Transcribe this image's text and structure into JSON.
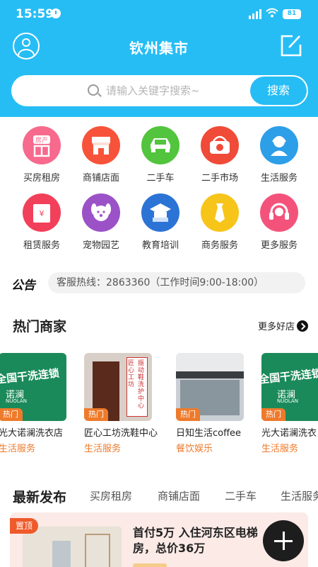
{
  "status": {
    "time": "15:59",
    "battery": "81"
  },
  "header": {
    "title": "钦州集市"
  },
  "search": {
    "placeholder": "请输入关键字搜索~",
    "button_label": "搜索"
  },
  "categories": [
    {
      "label": "买房租房",
      "icon": "house-icon",
      "color": "#f76a8d",
      "badge": "房产"
    },
    {
      "label": "商铺店面",
      "icon": "storefront-icon",
      "color": "#f7533a"
    },
    {
      "label": "二手车",
      "icon": "car-icon",
      "color": "#52c43d"
    },
    {
      "label": "二手市场",
      "icon": "basket-icon",
      "color": "#f04a38"
    },
    {
      "label": "生活服务",
      "icon": "service-person-icon",
      "color": "#2d9ee8"
    },
    {
      "label": "租赁服务",
      "icon": "rental-receipt-icon",
      "color": "#f2405a"
    },
    {
      "label": "宠物园艺",
      "icon": "dog-icon",
      "color": "#9b52c7"
    },
    {
      "label": "教育培训",
      "icon": "graduation-cap-icon",
      "color": "#2c73d6"
    },
    {
      "label": "商务服务",
      "icon": "necktie-icon",
      "color": "#f7c51a"
    },
    {
      "label": "更多服务",
      "icon": "headset-icon",
      "color": "#f3537a"
    }
  ],
  "notice": {
    "logo": "公告",
    "text": "客服热线：2863360（工作时间9:00-18:00）"
  },
  "hot_merchants": {
    "title": "热门商家",
    "more_label": "更多好店",
    "shops": [
      {
        "tag": "热门",
        "name": "光大诺澜洗衣店",
        "category": "生活服务",
        "sign": "全国干洗连锁",
        "brand": "诺澜",
        "brand_en": "NUOLAN"
      },
      {
        "tag": "热门",
        "name": "匠心工坊洗鞋中心",
        "category": "生活服务",
        "sign": "匠心工坊",
        "sign2": "振动鞋洗护中心"
      },
      {
        "tag": "热门",
        "name": "日知生活coffee",
        "category": "餐饮娱乐"
      },
      {
        "tag": "热门",
        "name": "光大诺澜洗衣",
        "category": "生活服务",
        "sign": "全国干洗连锁",
        "brand": "诺澜",
        "brand_en": "NUOLAN"
      }
    ]
  },
  "latest": {
    "title": "最新发布",
    "tabs": [
      "买房租房",
      "商铺店面",
      "二手车",
      "生活服务"
    ],
    "post": {
      "pin_tag": "置顶",
      "title": "首付5万 入住河东区电梯房，总价36万"
    }
  }
}
